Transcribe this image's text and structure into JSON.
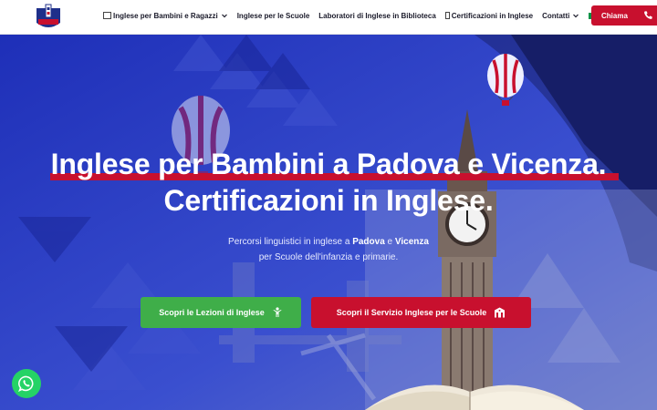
{
  "header": {
    "logo_text": "ENGLISH PLAYGROUND",
    "nav": [
      {
        "label": "Inglese per Bambini e Ragazzi",
        "has_icon": true,
        "dropdown": true
      },
      {
        "label": "Inglese per le Scuole",
        "has_icon": false,
        "dropdown": false
      },
      {
        "label": "Laboratori di Inglese in Biblioteca",
        "has_icon": false,
        "dropdown": false
      },
      {
        "label": "Certificazioni in Inglese",
        "has_icon": true,
        "dropdown": false
      },
      {
        "label": "Contatti",
        "has_icon": false,
        "dropdown": true
      }
    ],
    "language_flag": "it-flag-icon",
    "call_label": "Chiama"
  },
  "hero": {
    "title_line1": "Inglese per Bambini a Padova e Vicenza.",
    "title_line2": "Certificazioni in Inglese.",
    "subtitle_line1_pre": "Percorsi linguistici in inglese a ",
    "subtitle_city1": "Padova",
    "subtitle_and": " e ",
    "subtitle_city2": "Vicenza",
    "subtitle_line2": "per Scuole dell'infanzia e primarie.",
    "button_lessons": "Scopri le Lezioni di Inglese",
    "button_schools": "Scopri il Servizio Inglese per le Scuole"
  },
  "colors": {
    "brand_red": "#c8102e",
    "brand_green": "#3fae49",
    "hero_blue": "#2a3fbf",
    "whatsapp": "#25d366"
  }
}
